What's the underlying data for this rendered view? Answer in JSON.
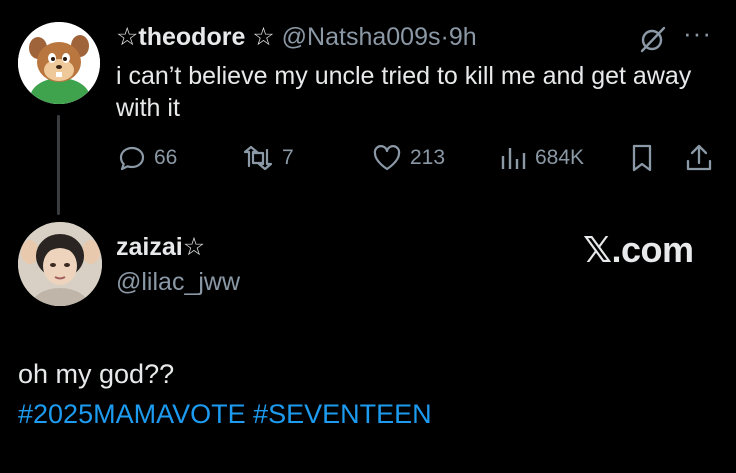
{
  "parent_tweet": {
    "display_name": "☆theodore ☆",
    "handle": "@Natsha009s",
    "separator": "·",
    "time": "9h",
    "text": "i can’t believe my uncle tried to kill me and get away with it",
    "metrics": {
      "replies": "66",
      "retweets": "7",
      "likes": "213",
      "views": "684K"
    },
    "more_label": "···"
  },
  "reply_tweet": {
    "display_name": "zaizai☆",
    "handle": "@lilac_jww",
    "text": "oh my god??",
    "hashtags": [
      "#2025MAMAVOTE",
      "#SEVENTEEN"
    ]
  },
  "watermark": "𝕏.com",
  "colors": {
    "background": "#000000",
    "text": "#e7e9ea",
    "secondary": "#8b98a5",
    "link": "#1d9bf0"
  }
}
